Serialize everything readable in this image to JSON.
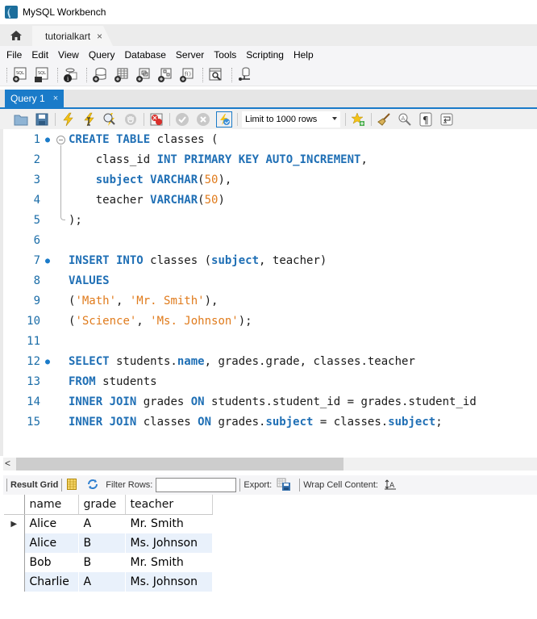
{
  "window": {
    "title": "MySQL Workbench"
  },
  "tabs": {
    "home_icon": "home-icon",
    "connection_tab": "tutorialkart",
    "close_glyph": "×"
  },
  "menu": [
    "File",
    "Edit",
    "View",
    "Query",
    "Database",
    "Server",
    "Tools",
    "Scripting",
    "Help"
  ],
  "main_toolbar": {
    "icons": [
      "new-sql-tab-icon",
      "open-sql-script-icon",
      "inspector-icon",
      "create-schema-icon",
      "create-table-icon",
      "create-view-icon",
      "create-procedure-icon",
      "create-function-icon",
      "search-table-data-icon",
      "reconnect-icon"
    ]
  },
  "query_tab": {
    "label": "Query 1",
    "close_glyph": "×"
  },
  "sql_toolbar": {
    "icons": [
      "open-folder-icon",
      "save-icon",
      "execute-icon",
      "execute-current-icon",
      "explain-icon",
      "stop-icon",
      "toggle-error-icon",
      "commit-icon",
      "rollback-icon",
      "autocommit-icon"
    ],
    "limit": "Limit to 1000 rows",
    "extra_icons": [
      "add-snippet-icon",
      "beautify-icon",
      "find-icon",
      "invisible-chars-icon",
      "wrap-icon"
    ]
  },
  "editor": {
    "lines": [
      {
        "n": "1",
        "dot": true,
        "tokens": [
          [
            "kw",
            "CREATE TABLE"
          ],
          [
            "id",
            " classes ("
          ]
        ]
      },
      {
        "n": "2",
        "dot": false,
        "tokens": [
          [
            "id",
            "    class_id "
          ],
          [
            "kw",
            "INT PRIMARY KEY AUTO_INCREMENT"
          ],
          [
            "id",
            ","
          ]
        ]
      },
      {
        "n": "3",
        "dot": false,
        "tokens": [
          [
            "id",
            "    "
          ],
          [
            "kw",
            "subject VARCHAR"
          ],
          [
            "id",
            "("
          ],
          [
            "num",
            "50"
          ],
          [
            "id",
            "),"
          ]
        ]
      },
      {
        "n": "4",
        "dot": false,
        "tokens": [
          [
            "id",
            "    teacher "
          ],
          [
            "kw",
            "VARCHAR"
          ],
          [
            "id",
            "("
          ],
          [
            "num",
            "50"
          ],
          [
            "id",
            ")"
          ]
        ]
      },
      {
        "n": "5",
        "dot": false,
        "tokens": [
          [
            "id",
            ");"
          ]
        ]
      },
      {
        "n": "6",
        "dot": false,
        "tokens": []
      },
      {
        "n": "7",
        "dot": true,
        "tokens": [
          [
            "kw",
            "INSERT INTO"
          ],
          [
            "id",
            " classes ("
          ],
          [
            "kw",
            "subject"
          ],
          [
            "id",
            ", teacher)"
          ]
        ]
      },
      {
        "n": "8",
        "dot": false,
        "tokens": [
          [
            "kw",
            "VALUES"
          ]
        ]
      },
      {
        "n": "9",
        "dot": false,
        "tokens": [
          [
            "id",
            "("
          ],
          [
            "str",
            "'Math'"
          ],
          [
            "id",
            ", "
          ],
          [
            "str",
            "'Mr. Smith'"
          ],
          [
            "id",
            "),"
          ]
        ]
      },
      {
        "n": "10",
        "dot": false,
        "tokens": [
          [
            "id",
            "("
          ],
          [
            "str",
            "'Science'"
          ],
          [
            "id",
            ", "
          ],
          [
            "str",
            "'Ms. Johnson'"
          ],
          [
            "id",
            ");"
          ]
        ]
      },
      {
        "n": "11",
        "dot": false,
        "tokens": []
      },
      {
        "n": "12",
        "dot": true,
        "tokens": [
          [
            "kw",
            "SELECT"
          ],
          [
            "id",
            " students."
          ],
          [
            "kw",
            "name"
          ],
          [
            "id",
            ", grades.grade, classes.teacher"
          ]
        ]
      },
      {
        "n": "13",
        "dot": false,
        "tokens": [
          [
            "kw",
            "FROM"
          ],
          [
            "id",
            " students"
          ]
        ]
      },
      {
        "n": "14",
        "dot": false,
        "tokens": [
          [
            "kw",
            "INNER JOIN"
          ],
          [
            "id",
            " grades "
          ],
          [
            "kw",
            "ON"
          ],
          [
            "id",
            " students.student_id = grades.student_id"
          ]
        ]
      },
      {
        "n": "15",
        "dot": false,
        "tokens": [
          [
            "kw",
            "INNER JOIN"
          ],
          [
            "id",
            " classes "
          ],
          [
            "kw",
            "ON"
          ],
          [
            "id",
            " grades."
          ],
          [
            "kw",
            "subject"
          ],
          [
            "id",
            " = classes."
          ],
          [
            "kw",
            "subject"
          ],
          [
            "id",
            ";"
          ]
        ]
      }
    ]
  },
  "scrollbar": {
    "left_arrow": "<"
  },
  "result_toolbar": {
    "result_grid": "Result Grid",
    "filter_rows": "Filter Rows:",
    "filter_value": "",
    "export": "Export:",
    "wrap": "Wrap Cell Content:"
  },
  "result_grid": {
    "columns": [
      "name",
      "grade",
      "teacher"
    ],
    "rows": [
      [
        "Alice",
        "A",
        "Mr. Smith"
      ],
      [
        "Alice",
        "B",
        "Ms. Johnson"
      ],
      [
        "Bob",
        "B",
        "Mr. Smith"
      ],
      [
        "Charlie",
        "A",
        "Ms. Johnson"
      ]
    ],
    "current_row_marker": "▶"
  },
  "colors": {
    "accent": "#1a7bc9",
    "keyword": "#1f6fb5",
    "string": "#e07b1c",
    "alt_row": "#e9f1fb"
  }
}
